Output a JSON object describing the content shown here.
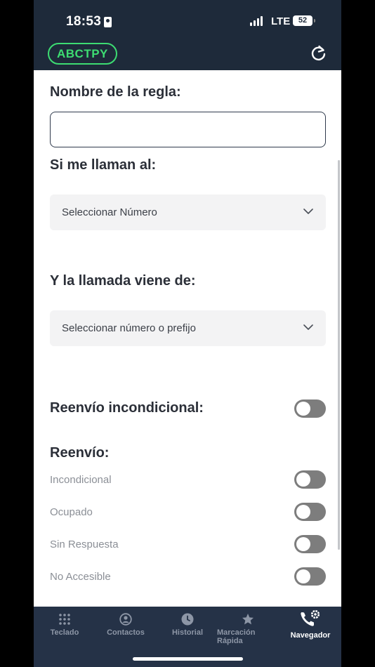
{
  "status_bar": {
    "time": "18:53",
    "network": "LTE",
    "battery": "52"
  },
  "header": {
    "account_badge": "ABCTPY",
    "refresh_icon": "refresh-icon"
  },
  "form": {
    "rule_name_label": "Nombre de la regla:",
    "rule_name_value": "",
    "if_called_label": "Si me llaman al:",
    "number_select": "Seleccionar Número",
    "call_from_label": "Y la llamada viene de:",
    "prefix_select": "Seleccionar número o prefijo",
    "unconditional_label": "Reenvío incondicional:",
    "unconditional_on": false,
    "forward_label": "Reenvío:",
    "forward_options": [
      {
        "label": "Incondicional",
        "on": false
      },
      {
        "label": "Ocupado",
        "on": false
      },
      {
        "label": "Sin Respuesta",
        "on": false
      },
      {
        "label": "No Accesible",
        "on": false
      }
    ]
  },
  "nav": {
    "items": [
      {
        "label": "Teclado",
        "icon": "keypad-icon"
      },
      {
        "label": "Contactos",
        "icon": "contacts-icon"
      },
      {
        "label": "Historial",
        "icon": "clock-icon"
      },
      {
        "label": "Marcación Rápida",
        "icon": "star-icon"
      },
      {
        "label": "Navegador",
        "icon": "phone-settings-icon"
      }
    ],
    "active": "Navegador"
  },
  "colors": {
    "header_bg": "#1e2a3a",
    "nav_bg": "#253247",
    "accent_green": "#3ddc72",
    "toggle_off": "#7d7d7d"
  }
}
